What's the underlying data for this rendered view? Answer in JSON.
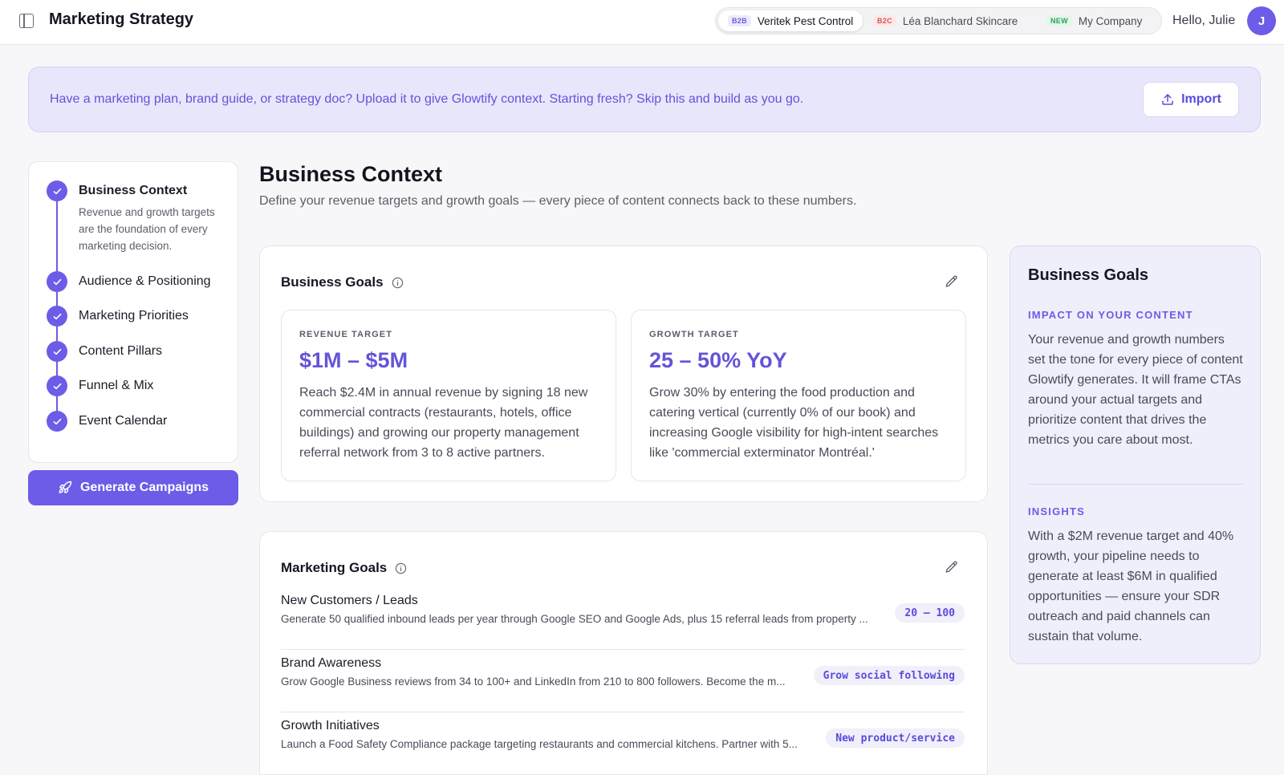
{
  "header": {
    "title": "Marketing Strategy",
    "greeting": "Hello, Julie",
    "avatar_initial": "J",
    "companies": [
      {
        "tag": "B2B",
        "name": "Veritek Pest Control",
        "active": true
      },
      {
        "tag": "B2C",
        "name": "Léa Blanchard Skincare",
        "active": false
      },
      {
        "tag": "NEW",
        "name": "My Company",
        "active": false
      }
    ]
  },
  "banner": {
    "text": "Have a marketing plan, brand guide, or strategy doc? Upload it to give Glowtify context. Starting fresh? Skip this and build as you go.",
    "import_label": "Import"
  },
  "stepper": {
    "steps": [
      {
        "label": "Business Context",
        "description": "Revenue and growth targets are the foundation of every marketing decision.",
        "active": true
      },
      {
        "label": "Audience & Positioning"
      },
      {
        "label": "Marketing Priorities"
      },
      {
        "label": "Content Pillars"
      },
      {
        "label": "Funnel & Mix"
      },
      {
        "label": "Event Calendar"
      }
    ],
    "generate_label": "Generate Campaigns"
  },
  "main": {
    "title": "Business Context",
    "subtitle": "Define your revenue targets and growth goals — every piece of content connects back to these numbers.",
    "business_goals": {
      "title": "Business Goals",
      "revenue": {
        "label": "REVENUE TARGET",
        "value": "$1M – $5M",
        "description": "Reach $2.4M in annual revenue by signing 18 new commercial contracts (restaurants, hotels, office buildings) and growing our property management referral network from 3 to 8 active partners."
      },
      "growth": {
        "label": "GROWTH TARGET",
        "value": "25 – 50% YoY",
        "description": "Grow 30% by entering the food production and catering vertical (currently 0% of our book) and increasing Google visibility for high-intent searches like 'commercial exterminator Montréal.'"
      }
    },
    "marketing_goals": {
      "title": "Marketing Goals",
      "items": [
        {
          "title": "New Customers / Leads",
          "description": "Generate 50 qualified inbound leads per year through Google SEO and Google Ads, plus 15 referral leads from property ...",
          "badge": "20 – 100"
        },
        {
          "title": "Brand Awareness",
          "description": "Grow Google Business reviews from 34 to 100+ and LinkedIn from 210 to 800 followers. Become the m...",
          "badge": "Grow social following"
        },
        {
          "title": "Growth Initiatives",
          "description": "Launch a Food Safety Compliance package targeting restaurants and commercial kitchens. Partner with 5...",
          "badge": "New product/service"
        }
      ]
    }
  },
  "side_panel": {
    "title": "Business Goals",
    "impact_label": "IMPACT ON YOUR CONTENT",
    "impact_text": "Your revenue and growth numbers set the tone for every piece of content Glowtify generates. It will frame CTAs around your actual targets and prioritize content that drives the metrics you care about most.",
    "insights_label": "INSIGHTS",
    "insights_text": "With a $2M revenue target and 40% growth, your pipeline needs to generate at least $6M in qualified opportunities — ensure your SDR outreach and paid channels can sustain that volume."
  },
  "colors": {
    "accent": "#6c5ce7",
    "banner_bg": "#e8e6fb",
    "panel_bg": "#efeefb"
  }
}
